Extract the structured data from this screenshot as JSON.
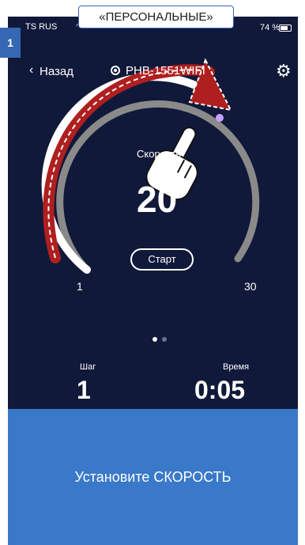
{
  "status": {
    "carrier": "TS RUS",
    "battery": "74 %"
  },
  "step_badge": "1",
  "top_label": "«ПЕРСОНАЛЬНЫЕ»",
  "header": {
    "back_label": "Назад",
    "device_name": "PHB-1551WIFI"
  },
  "dial": {
    "label": "Скорость",
    "value": "20",
    "min": "1",
    "max": "30",
    "start_label": "Старт"
  },
  "footer": {
    "step_label": "Шаг",
    "step_value": "1",
    "time_label": "Время",
    "time_value": "0:05"
  },
  "instruction": "Установите СКОРОСТЬ",
  "colors": {
    "background": "#11193a",
    "track": "#8a8a8a",
    "arrow": "#b01f1f",
    "badge": "#3668b4",
    "panel": "#3a79c9"
  }
}
